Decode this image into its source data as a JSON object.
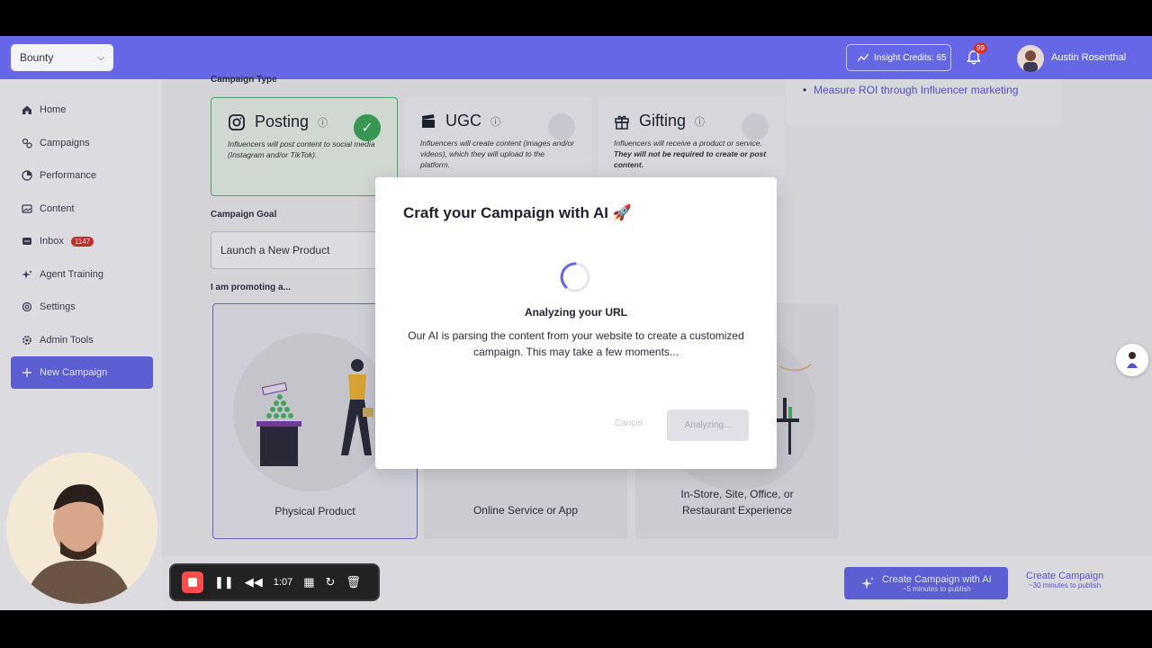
{
  "topbar": {
    "workspace": "Bounty",
    "insight_credits": "Insight Credits: 65",
    "notification_count": "99",
    "user_name": "Austin Rosenthal"
  },
  "sidebar": {
    "items": [
      {
        "label": "Home",
        "icon": "home-icon"
      },
      {
        "label": "Campaigns",
        "icon": "campaigns-icon"
      },
      {
        "label": "Performance",
        "icon": "performance-icon"
      },
      {
        "label": "Content",
        "icon": "content-icon"
      },
      {
        "label": "Inbox",
        "icon": "inbox-icon",
        "badge": "1147"
      },
      {
        "label": "Agent Training",
        "icon": "sparkle-icon"
      },
      {
        "label": "Settings",
        "icon": "settings-icon"
      },
      {
        "label": "Admin Tools",
        "icon": "gear-icon"
      },
      {
        "label": "New Campaign",
        "icon": "plus-icon",
        "active": true
      }
    ]
  },
  "main": {
    "campaign_type_label": "Campaign Type",
    "types": [
      {
        "title": "Posting",
        "desc": "Influencers will post content to social media (Instagram and/or TikTok).",
        "selected": true
      },
      {
        "title": "UGC",
        "desc": "Influencers will create content (images and/or videos), which they will upload to the platform."
      },
      {
        "title": "Gifting",
        "desc_plain": "Influencers will receive a product or service.",
        "desc_bold": "They will not be required to create or post content."
      }
    ],
    "goal_label": "Campaign Goal",
    "goal_value": "Launch a New Product",
    "promoting_label": "I am promoting a...",
    "promo_options": [
      {
        "label": "Physical Product",
        "selected": true
      },
      {
        "label": "Online Service or App"
      },
      {
        "label_line1": "In-Store, Site, Office, or",
        "label_line2": "Restaurant Experience"
      }
    ],
    "ai_hint_item": "Measure ROI through Influencer marketing"
  },
  "bottombar": {
    "create_ai_label": "Create Campaign with AI",
    "create_ai_sub": "~5 minutes to publish",
    "create_label": "Create Campaign",
    "create_sub": "~30 minutes to publish"
  },
  "modal": {
    "title": "Craft your Campaign with AI 🚀",
    "status_title": "Analyzing your URL",
    "status_text": "Our AI is parsing the content from your website to create a customized campaign. This may take a few moments...",
    "cancel_label": "Cancel",
    "analyzing_label": "Analyzing..."
  },
  "recorder": {
    "timer": "1:07"
  },
  "colors": {
    "accent": "#6366e9",
    "success": "#3da55a",
    "badge": "#d7302f"
  }
}
